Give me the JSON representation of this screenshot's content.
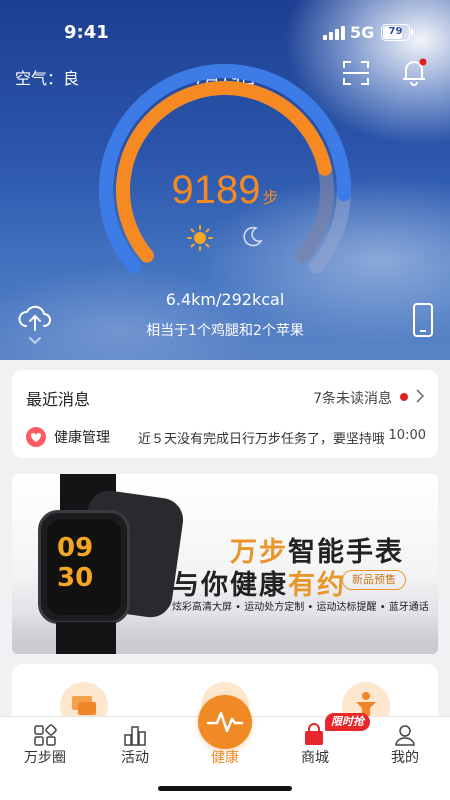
{
  "status_bar": {
    "time": "9:41",
    "network": "5G",
    "battery": "79",
    "battery_level": 0.79
  },
  "header": {
    "air_quality": "空气：良",
    "date": "7月19日"
  },
  "steps": {
    "count": "9189",
    "unit": "步",
    "distance_calories": "6.4km/292kcal",
    "equivalent": "相当于1个鸡腿和2个苹果"
  },
  "messages": {
    "title": "最近消息",
    "unread": "7条未读消息",
    "items": [
      {
        "source": "健康管理",
        "text": "近５天没有完成日行万步任务了，要坚持哦",
        "time": "10:00"
      }
    ]
  },
  "banner": {
    "line1_a": "万步",
    "line1_b": "智能手表",
    "line2_a": "与你健康",
    "line2_b": "有约",
    "badge": "新品预售",
    "features": "炫彩高清大屏 • 运动处方定制 • 运动达标提醒 • 蓝牙通话",
    "watch_time_h": "09",
    "watch_time_m": "30"
  },
  "tabbar": {
    "tabs": [
      {
        "label": "万步圈"
      },
      {
        "label": "活动"
      },
      {
        "label": "健康"
      },
      {
        "label": "商城"
      },
      {
        "label": "我的"
      }
    ],
    "promo": "限时抢"
  },
  "colors": {
    "accent": "#f08a24",
    "gauge_blue": "#3d7be6",
    "notification_red": "#e21d1d"
  }
}
